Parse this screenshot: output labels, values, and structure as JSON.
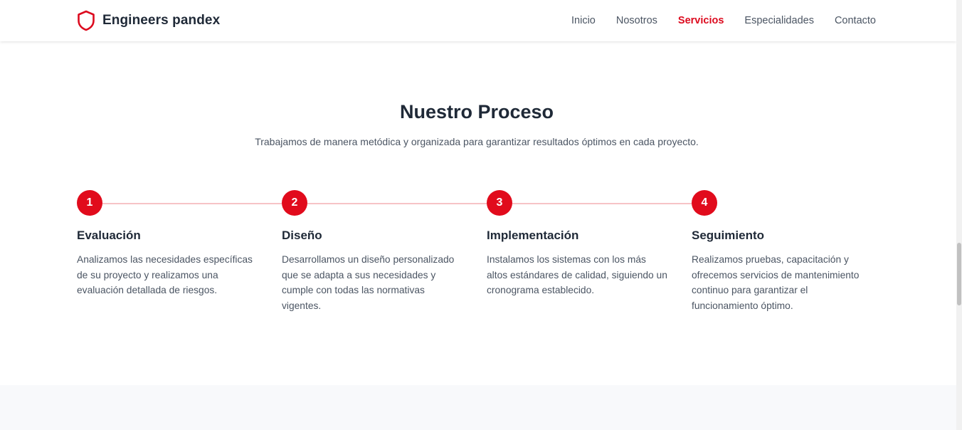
{
  "brand": {
    "name": "Engineers pandex",
    "icon": "shield-icon",
    "accent": "#dc0a1e"
  },
  "nav": {
    "items": [
      {
        "label": "Inicio",
        "active": false
      },
      {
        "label": "Nosotros",
        "active": false
      },
      {
        "label": "Servicios",
        "active": true
      },
      {
        "label": "Especialidades",
        "active": false
      },
      {
        "label": "Contacto",
        "active": false
      }
    ]
  },
  "process": {
    "title": "Nuestro Proceso",
    "subtitle": "Trabajamos de manera metódica y organizada para garantizar resultados óptimos en cada proyecto.",
    "steps": [
      {
        "number": "1",
        "title": "Evaluación",
        "text": "Analizamos las necesidades específicas de su proyecto y realizamos una evaluación detallada de riesgos."
      },
      {
        "number": "2",
        "title": "Diseño",
        "text": "Desarrollamos un diseño personalizado que se adapta a sus necesidades y cumple con todas las normativas vigentes."
      },
      {
        "number": "3",
        "title": "Implementación",
        "text": "Instalamos los sistemas con los más altos estándares de calidad, siguiendo un cronograma establecido."
      },
      {
        "number": "4",
        "title": "Seguimiento",
        "text": "Realizamos pruebas, capacitación y ofrecemos servicios de mantenimiento continuo para garantizar el funcionamiento óptimo."
      }
    ]
  },
  "colors": {
    "step_circle": "#e10b1c",
    "connector": "#f6c3c6",
    "heading": "#1f2937",
    "body_text": "#4b5563"
  }
}
